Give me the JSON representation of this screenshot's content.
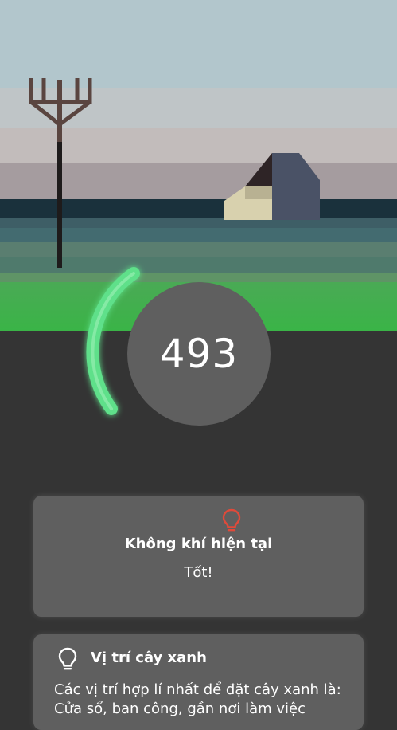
{
  "reading": {
    "value": "493"
  },
  "air_card": {
    "title": "Không khí hiện tại",
    "status": "Tốt!",
    "icon": "lightbulb-icon",
    "icon_color": "#e04a3a"
  },
  "plant_card": {
    "title": "Vị trí cây xanh",
    "description": "Các vị trí hợp lí nhất để đặt cây xanh là: Cửa sổ, ban công, gần nơi làm việc",
    "icon": "lightbulb-icon",
    "icon_color": "#ffffff"
  },
  "colors": {
    "background": "#343434",
    "card": "#5f5f5f",
    "gauge_arc": "#5ee08a",
    "grass": "#3fbf4c"
  }
}
